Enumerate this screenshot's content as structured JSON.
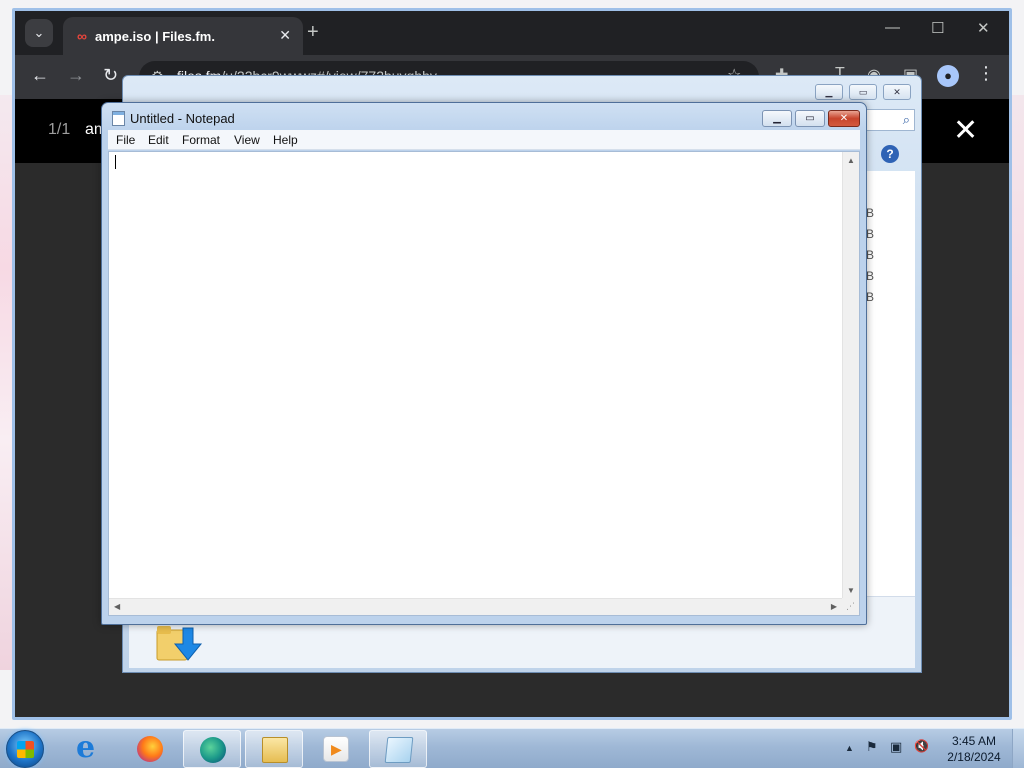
{
  "browser": {
    "tab_title": "ampe.iso | Files.fm.",
    "tab_search_glyph": "⌄",
    "new_tab_glyph": "+",
    "url_host": "files.fm",
    "url_path": "/u/22bcr9wwwz#/view/772buvqhhy",
    "controls": {
      "minimize": "—",
      "maximize": "☐",
      "close": "✕"
    }
  },
  "viewer": {
    "counter": "1/1",
    "filename": "am",
    "close_glyph": "✕"
  },
  "dialog": {
    "size_cells": [
      "B",
      "B",
      "B",
      "B",
      "B"
    ],
    "help_glyph": "?",
    "search_glyph": "⌕"
  },
  "notepad": {
    "title": "Untitled - Notepad",
    "menu": [
      "File",
      "Edit",
      "Format",
      "View",
      "Help"
    ],
    "content": ""
  },
  "taskbar": {
    "clock_time": "3:45 AM",
    "clock_date": "2/18/2024",
    "tray_glyphs": [
      "▲",
      "⚑",
      "▣",
      "🔇"
    ]
  },
  "icons": [
    "search-icon",
    "back-arrow-icon",
    "forward-arrow-icon",
    "reload-icon",
    "site-info-icon",
    "star-icon",
    "extensions-icon",
    "profile-icon",
    "menu-dots-icon",
    "help-icon",
    "folder-download-icon",
    "notepad-icon",
    "windows-start-icon",
    "internet-explorer-icon",
    "firefox-icon",
    "edge-icon",
    "file-explorer-icon",
    "media-player-icon",
    "flag-icon",
    "network-icon",
    "volume-muted-icon"
  ]
}
